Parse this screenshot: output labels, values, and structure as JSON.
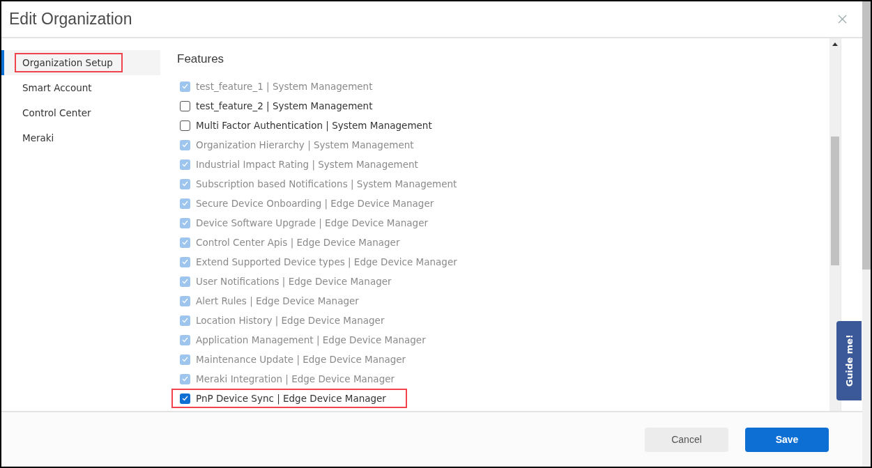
{
  "dialog": {
    "title": "Edit Organization"
  },
  "sidebar": {
    "items": [
      {
        "label": "Organization Setup",
        "selected": true,
        "highlighted": true
      },
      {
        "label": "Smart Account",
        "selected": false,
        "highlighted": false
      },
      {
        "label": "Control Center",
        "selected": false,
        "highlighted": false
      },
      {
        "label": "Meraki",
        "selected": false,
        "highlighted": false
      }
    ]
  },
  "features": {
    "heading": "Features",
    "items": [
      {
        "label": "test_feature_1 | System Management",
        "checked": true,
        "disabled": true,
        "highlighted": false
      },
      {
        "label": "test_feature_2 | System Management",
        "checked": false,
        "disabled": false,
        "highlighted": false
      },
      {
        "label": "Multi Factor Authentication | System Management",
        "checked": false,
        "disabled": false,
        "highlighted": false
      },
      {
        "label": "Organization Hierarchy | System Management",
        "checked": true,
        "disabled": true,
        "highlighted": false
      },
      {
        "label": "Industrial Impact Rating | System Management",
        "checked": true,
        "disabled": true,
        "highlighted": false
      },
      {
        "label": "Subscription based Notifications | System Management",
        "checked": true,
        "disabled": true,
        "highlighted": false
      },
      {
        "label": "Secure Device Onboarding | Edge Device Manager",
        "checked": true,
        "disabled": true,
        "highlighted": false
      },
      {
        "label": "Device Software Upgrade | Edge Device Manager",
        "checked": true,
        "disabled": true,
        "highlighted": false
      },
      {
        "label": "Control Center Apis | Edge Device Manager",
        "checked": true,
        "disabled": true,
        "highlighted": false
      },
      {
        "label": "Extend Supported Device types | Edge Device Manager",
        "checked": true,
        "disabled": true,
        "highlighted": false
      },
      {
        "label": "User Notifications | Edge Device Manager",
        "checked": true,
        "disabled": true,
        "highlighted": false
      },
      {
        "label": "Alert Rules | Edge Device Manager",
        "checked": true,
        "disabled": true,
        "highlighted": false
      },
      {
        "label": "Location History | Edge Device Manager",
        "checked": true,
        "disabled": true,
        "highlighted": false
      },
      {
        "label": "Application Management | Edge Device Manager",
        "checked": true,
        "disabled": true,
        "highlighted": false
      },
      {
        "label": "Maintenance Update | Edge Device Manager",
        "checked": true,
        "disabled": true,
        "highlighted": false
      },
      {
        "label": "Meraki Integration | Edge Device Manager",
        "checked": true,
        "disabled": true,
        "highlighted": false
      },
      {
        "label": "PnP Device Sync | Edge Device Manager",
        "checked": true,
        "disabled": false,
        "highlighted": true
      }
    ]
  },
  "footer": {
    "buttons": [
      {
        "label": "Cancel",
        "kind": "secondary"
      },
      {
        "label": "Save",
        "kind": "primary"
      }
    ]
  },
  "guide_tab": {
    "label": "Guide me!"
  }
}
